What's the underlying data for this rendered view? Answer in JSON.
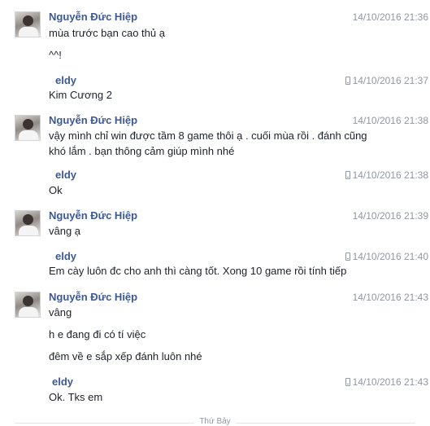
{
  "messages": [
    {
      "sender": "Nguyễn Đức Hiệp",
      "time": "14/10/2016 21:36",
      "lines": [
        "mùa trước bạn cao thủ ạ",
        "^^!"
      ]
    },
    {
      "sender": "eldy",
      "time": "14/10/2016 21:37",
      "lines": [
        "Kim Cương 2"
      ]
    },
    {
      "sender": "Nguyễn Đức Hiệp",
      "time": "14/10/2016 21:38",
      "lines": [
        "vậy mình chỉ win được tầm 8 game thôi ạ . cuối mùa rồi . đánh cũng khó lắm . bạn thông cảm giúp mình nhé"
      ]
    },
    {
      "sender": "eldy",
      "time": "14/10/2016 21:38",
      "lines": [
        "Ok"
      ]
    },
    {
      "sender": "Nguyễn Đức Hiệp",
      "time": "14/10/2016 21:39",
      "lines": [
        "vâng ạ"
      ]
    },
    {
      "sender": "eldy",
      "time": "14/10/2016 21:40",
      "lines": [
        "Em cày luôn đc cho anh thì càng tốt. Xong 10 game rồi tính tiếp"
      ]
    },
    {
      "sender": "Nguyễn Đức Hiệp",
      "time": "14/10/2016 21:43",
      "lines": [
        "vâng",
        "h e đang đi có tí việc",
        "đêm về e sắp xếp đánh luôn nhé"
      ]
    },
    {
      "sender": "eldy",
      "time": "14/10/2016 21:43",
      "lines": [
        "Ok. Tks em"
      ]
    }
  ],
  "day_divider": "Thứ Bảy"
}
